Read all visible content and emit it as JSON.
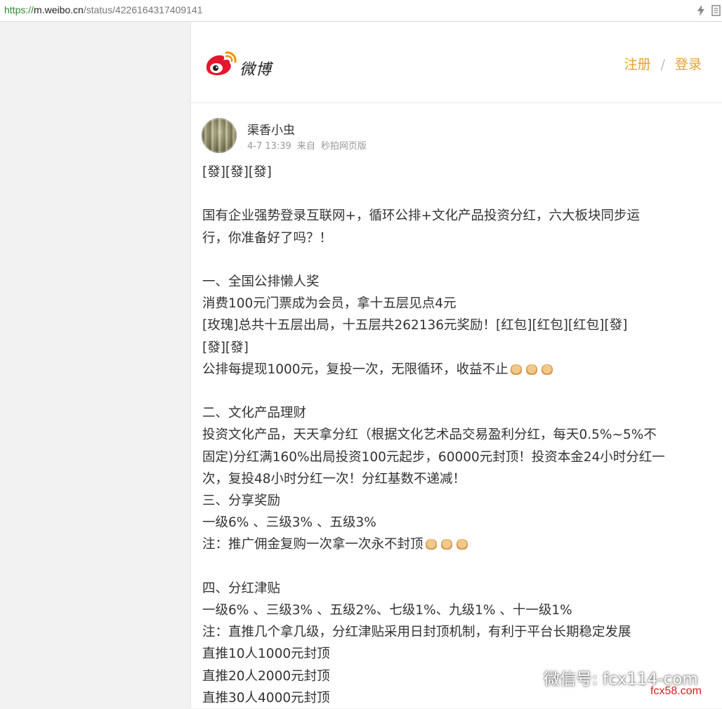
{
  "browser": {
    "url_scheme": "https://",
    "url_domain": "m.weibo.cn",
    "url_path": "/status/4226164317409141"
  },
  "header": {
    "logo_text": "微博",
    "register_label": "注册",
    "separator": "/",
    "login_label": "登录",
    "accent_color": "#e8a02a"
  },
  "post": {
    "username": "渠香小虫",
    "time": "4-7 13:39",
    "source_prefix": "来自",
    "source": "秒拍网页版",
    "lines": [
      "[發][發][發]",
      "",
      "国有企业强势登录互联网+，循环公排+文化产品投资分红，六大板块同步运",
      "行，你准备好了吗？！",
      "",
      "一、全国公排懒人奖",
      "消费100元门票成为会员，拿十五层见点4元",
      "[玫瑰]总共十五层出局，十五层共262136元奖励！[红包][红包][红包][發]",
      "[發][發]",
      "公排每提现1000元，复投一次，无限循环，收益不止",
      "",
      "二、文化产品理财",
      "投资文化产品，天天拿分红（根据文化艺术品交易盈利分红，每天0.5%~5%不",
      "固定)分红满160%出局投资100元起步，60000元封顶！投资本金24小时分红一",
      "次，复投48小时分红一次！分红基数不递减！",
      "三、分享奖励",
      "一级6% 、三级3% 、五级3%",
      "注：推广佣金复购一次拿一次永不封顶",
      "",
      "四、分红津贴",
      "一级6% 、三级3% 、五级2%、七级1%、九级1% 、十一级1%",
      "注：直推几个拿几级，分红津贴采用日封顶机制，有利于平台长期稳定发展",
      "直推10人1000元封顶",
      "直推20人2000元封顶",
      "直推30人4000元封顶"
    ]
  },
  "watermark": {
    "wechat_text": "微信号: fcx114-com",
    "site_text": "fcx58.com"
  }
}
